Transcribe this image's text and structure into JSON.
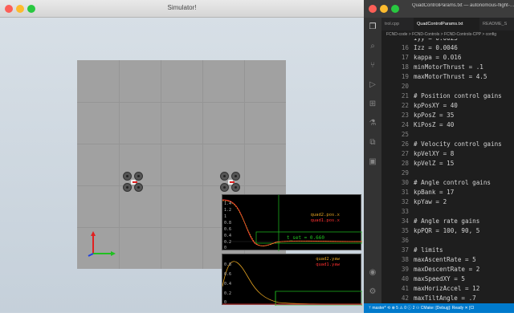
{
  "simulator": {
    "title": "Simulator!",
    "plot1": {
      "legend": [
        "quad2.pos.x",
        "quad1.pos.x"
      ],
      "yticks": [
        "1.4",
        "1.2",
        "1",
        "0.8",
        "0.6",
        "0.4",
        "0.2",
        "0"
      ],
      "annotation": "t_set = 0.660",
      "colors": {
        "quad1": "#ff3030",
        "quad2": "#e0a020",
        "marker": "#20c020"
      }
    },
    "plot2": {
      "legend": [
        "quad2.yaw",
        "quad1.yaw"
      ],
      "yticks": [
        "0.8",
        "0.6",
        "0.4",
        "0.2",
        "0"
      ]
    }
  },
  "vscode": {
    "window_title": "QuadControlParams.txt — autonomous-flight-…",
    "tabs": [
      "trol.cpp",
      "QuadControlParams.txt",
      "README_S"
    ],
    "breadcrumb": "FCND-code > FCND-Controls > FCND-Controls-CPP > config",
    "status": "ᛘ master*  ⟲  ⊗ 5 ⚠ 0 ⓘ 2  ⚇  CMake: [Debug]: Ready  ✕ [Cl",
    "lines": [
      {
        "n": "",
        "t": "Iyy = 0.0023"
      },
      {
        "n": "16",
        "t": "Izz = 0.0046"
      },
      {
        "n": "17",
        "t": "kappa = 0.016"
      },
      {
        "n": "18",
        "t": "minMotorThrust = .1"
      },
      {
        "n": "19",
        "t": "maxMotorThrust = 4.5"
      },
      {
        "n": "20",
        "t": ""
      },
      {
        "n": "21",
        "t": "# Position control gains"
      },
      {
        "n": "22",
        "t": "kpPosXY = 40"
      },
      {
        "n": "23",
        "t": "kpPosZ = 35"
      },
      {
        "n": "24",
        "t": "KiPosZ = 40"
      },
      {
        "n": "25",
        "t": ""
      },
      {
        "n": "26",
        "t": "# Velocity control gains"
      },
      {
        "n": "27",
        "t": "kpVelXY = 8"
      },
      {
        "n": "28",
        "t": "kpVelZ = 15"
      },
      {
        "n": "29",
        "t": ""
      },
      {
        "n": "30",
        "t": "# Angle control gains"
      },
      {
        "n": "31",
        "t": "kpBank = 17"
      },
      {
        "n": "32",
        "t": "kpYaw = 2"
      },
      {
        "n": "33",
        "t": ""
      },
      {
        "n": "34",
        "t": "# Angle rate gains"
      },
      {
        "n": "35",
        "t": "kpPQR = 100, 90, 5"
      },
      {
        "n": "36",
        "t": ""
      },
      {
        "n": "37",
        "t": "# limits"
      },
      {
        "n": "38",
        "t": "maxAscentRate = 5"
      },
      {
        "n": "39",
        "t": "maxDescentRate = 2"
      },
      {
        "n": "40",
        "t": "maxSpeedXY = 5"
      },
      {
        "n": "41",
        "t": "maxHorizAccel = 12"
      },
      {
        "n": "42",
        "t": "maxTiltAngle = .7"
      }
    ]
  }
}
